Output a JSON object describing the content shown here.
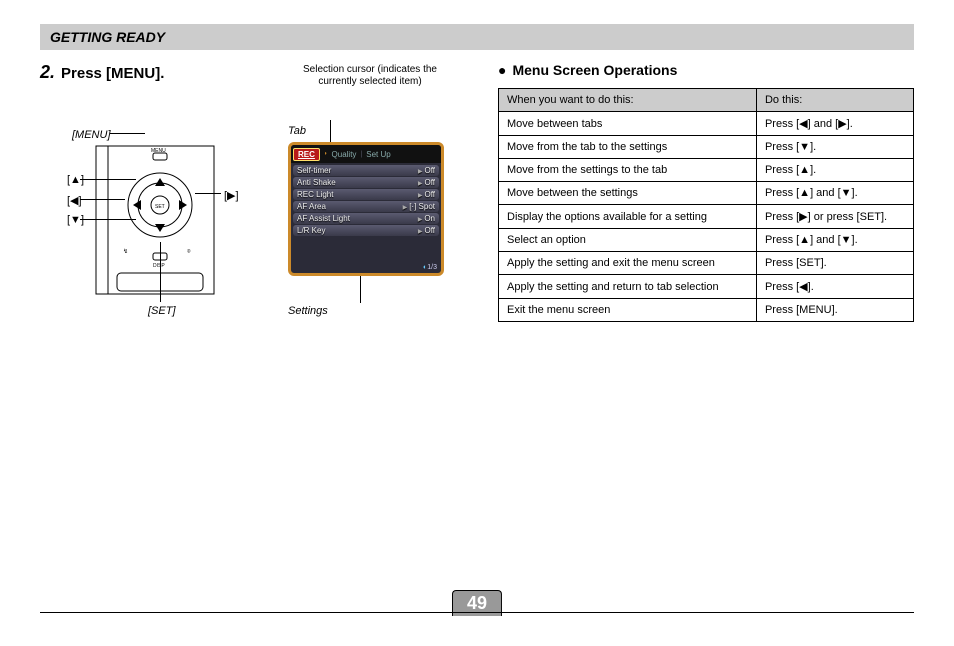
{
  "section_header": "GETTING READY",
  "step": {
    "number": "2.",
    "text": "Press [MENU]."
  },
  "cursor_note": "Selection cursor (indicates the currently selected item)",
  "labels": {
    "menu": "[MENU]",
    "up": "[▲]",
    "left": "[◀]",
    "down": "[▼]",
    "right": "[▶]",
    "set": "[SET]",
    "tab": "Tab",
    "settings": "Settings"
  },
  "screen": {
    "tabs": {
      "rec": "REC",
      "quality": "Quality",
      "setup": "Set Up"
    },
    "rows": [
      {
        "name": "Self-timer",
        "value": "Off"
      },
      {
        "name": "Anti Shake",
        "value": "Off"
      },
      {
        "name": "REC Light",
        "value": "Off"
      },
      {
        "name": "AF Area",
        "value": "[·] Spot"
      },
      {
        "name": "AF Assist Light",
        "value": "On"
      },
      {
        "name": "L/R Key",
        "value": "Off"
      }
    ],
    "page": "1/3"
  },
  "right_heading": "Menu Screen Operations",
  "table": {
    "head_left": "When you want to do this:",
    "head_right": "Do this:",
    "rows": [
      {
        "want": "Move between tabs",
        "do": "Press [◀] and [▶]."
      },
      {
        "want": "Move from the tab to the settings",
        "do": "Press [▼]."
      },
      {
        "want": "Move from the settings to the tab",
        "do": "Press [▲]."
      },
      {
        "want": "Move between the settings",
        "do": "Press [▲] and [▼]."
      },
      {
        "want": "Display the options available for a setting",
        "do": "Press [▶] or press [SET]."
      },
      {
        "want": "Select an option",
        "do": "Press [▲] and [▼]."
      },
      {
        "want": "Apply the setting and exit the menu screen",
        "do": "Press [SET]."
      },
      {
        "want": "Apply the setting and return to tab selection",
        "do": "Press [◀]."
      },
      {
        "want": "Exit the menu screen",
        "do": "Press [MENU]."
      }
    ]
  },
  "page_number": "49"
}
